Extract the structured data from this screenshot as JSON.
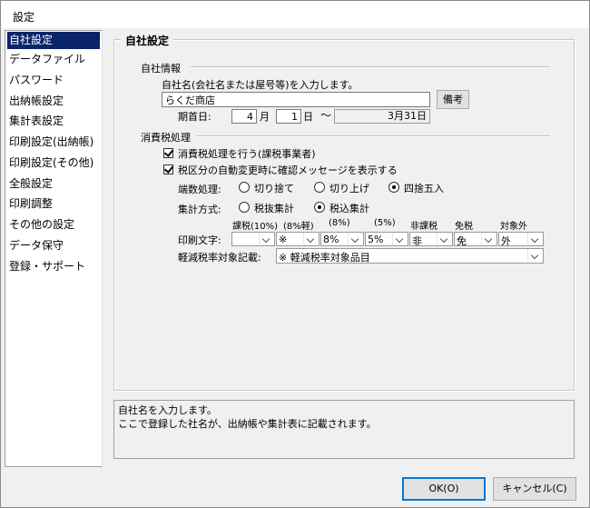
{
  "window": {
    "title": "設定"
  },
  "sidebar": {
    "items": [
      {
        "label": "自社設定",
        "selected": true
      },
      {
        "label": "データファイル"
      },
      {
        "label": "パスワード"
      },
      {
        "label": "出納帳設定"
      },
      {
        "label": "集計表設定"
      },
      {
        "label": "印刷設定(出納帳)"
      },
      {
        "label": "印刷設定(その他)"
      },
      {
        "label": "全般設定"
      },
      {
        "label": "印刷調整"
      },
      {
        "label": "その他の設定"
      },
      {
        "label": "データ保守"
      },
      {
        "label": "登録・サポート"
      }
    ]
  },
  "panel": {
    "title": "自社設定",
    "company": {
      "section_label": "自社情報",
      "name_prompt": "自社名(会社名または屋号等)を入力します。",
      "name_value": "らくだ商店",
      "note_button": "備考",
      "period_label": "期首日:",
      "month_value": "4",
      "month_unit": "月",
      "day_value": "1",
      "day_unit": "日",
      "tilde": "～",
      "end_date": "3月31日"
    },
    "tax": {
      "section_label": "消費税処理",
      "check_tax_processing": {
        "label": "消費税処理を行う(課税事業者)",
        "checked": true
      },
      "check_auto_confirm": {
        "label": "税区分の自動変更時に確認メッセージを表示する",
        "checked": true
      },
      "rounding_label": "端数処理:",
      "rounding_options": [
        {
          "label": "切り捨て",
          "selected": false
        },
        {
          "label": "切り上げ",
          "selected": false
        },
        {
          "label": "四捨五入",
          "selected": true
        }
      ],
      "aggregation_label": "集計方式:",
      "aggregation_options": [
        {
          "label": "税抜集計",
          "selected": false
        },
        {
          "label": "税込集計",
          "selected": true
        }
      ],
      "print_headers": [
        "課税(10%)",
        "(8%軽)",
        "(8%)",
        "(5%)",
        "非課税",
        "免税",
        "対象外"
      ],
      "print_label": "印刷文字:",
      "print_values": [
        "",
        "※",
        "8%",
        "5%",
        "非",
        "免",
        "外"
      ],
      "reduced_label": "軽減税率対象記載:",
      "reduced_value": "※ 軽減税率対象品目"
    }
  },
  "help": {
    "line1": "自社名を入力します。",
    "line2": "ここで登録した社名が、出納帳や集計表に記載されます。"
  },
  "footer": {
    "ok_label": "OK(O)",
    "cancel_label": "キャンセル(C)"
  }
}
